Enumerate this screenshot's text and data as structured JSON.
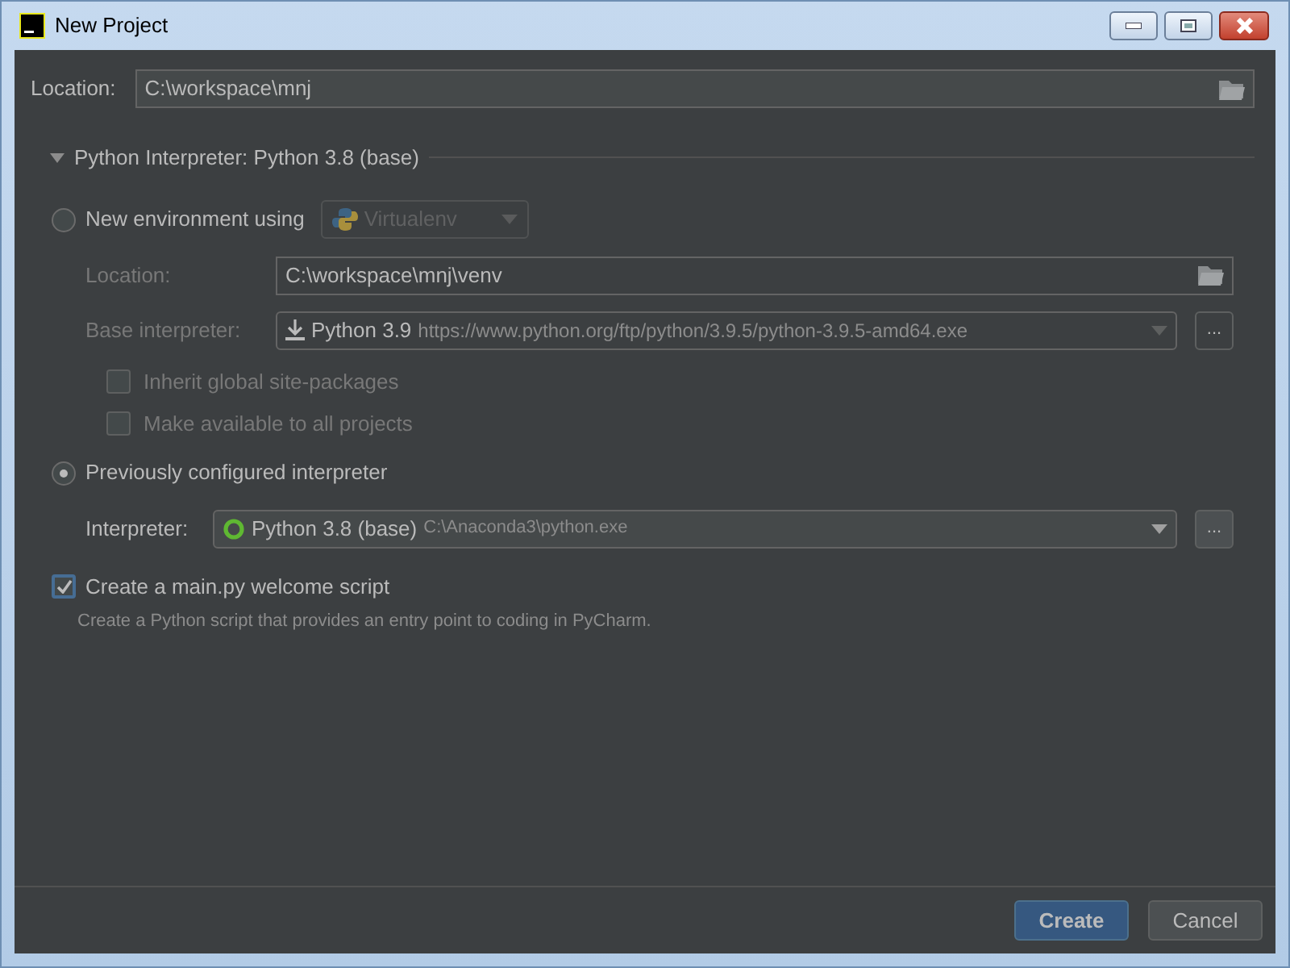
{
  "window": {
    "title": "New Project"
  },
  "location": {
    "label": "Location:",
    "value": "C:\\workspace\\mnj"
  },
  "section": {
    "title": "Python Interpreter: Python 3.8 (base)",
    "expanded": true
  },
  "options": [
    {
      "label": "New environment using",
      "selected": false,
      "tool": "Virtualenv",
      "fields": [
        {
          "kind": "path",
          "label": "Location:",
          "value": "C:\\workspace\\mnj\\venv"
        },
        {
          "kind": "download",
          "label": "Base interpreter:",
          "name": "Python 3.9",
          "detail": "https://www.python.org/ftp/python/3.9.5/python-3.9.5-amd64.exe",
          "browse": "..."
        }
      ],
      "checkboxes": [
        {
          "label": "Inherit global site-packages",
          "checked": false
        },
        {
          "label": "Make available to all projects",
          "checked": false
        }
      ]
    },
    {
      "label": "Previously configured interpreter",
      "selected": true,
      "fields": [
        {
          "kind": "local",
          "label": "Interpreter:",
          "name": "Python 3.8 (base)",
          "detail": "C:\\Anaconda3\\python.exe",
          "browse": "..."
        }
      ]
    }
  ],
  "welcome": {
    "label": "Create a main.py welcome script",
    "checked": true,
    "hint": "Create a Python script that provides an entry point to coding in PyCharm."
  },
  "buttons": [
    {
      "label": "Create",
      "kind": "primary"
    },
    {
      "label": "Cancel",
      "kind": "secondary"
    }
  ]
}
